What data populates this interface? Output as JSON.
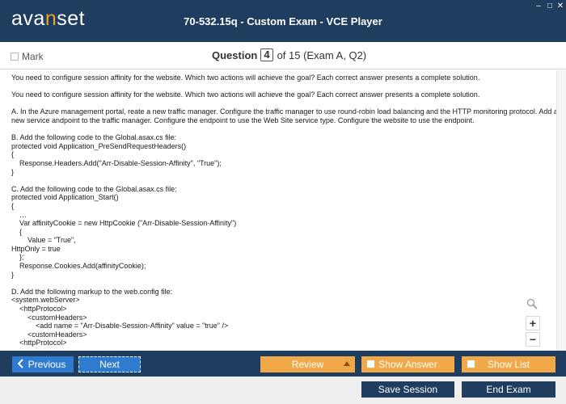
{
  "app": {
    "logo_prefix": "ava",
    "logo_accent": "n",
    "logo_suffix": "set",
    "window_title": "70-532.15q - Custom Exam - VCE Player"
  },
  "window_controls": {
    "close": "✕",
    "maximize": "□",
    "minimize": "‒"
  },
  "question_bar": {
    "mark_label": "Mark",
    "question_label": "Question",
    "question_number": "4",
    "question_of": "of 15 (Exam A, Q2)"
  },
  "content": {
    "lines": [
      "You need to configure session affinity for the website. Which two actions will achieve the goal? Each correct answer presents a complete solution.",
      "",
      "You need to configure session affinity for the website. Which two actions will achieve the goal? Each correct answer presents a complete solution.",
      "",
      "A. In the Azure management portal, reate a new traffic manager. Configure the traffic manager to use round-robin load balancing and the HTTP monitoring protocol. Add a",
      "new service andpoint to the traffic manager. Configure the endpoint to use the Web Site service type. Configure the website to use the endpoint.",
      "",
      "B. Add the following code to the Global.asax.cs file:",
      "protected void Application_PreSendRequestHeaders()",
      "{",
      "    Response.Headers.Add(\"Arr-Disable-Session-Affinity\", \"True\");",
      "}",
      "",
      "C. Add the following code to the Global.asax.cs file:",
      "protected void Application_Start()",
      "{",
      "    …",
      "    Var affinityCookie = new HttpCookie (\"Arr-Disable-Session-Affinity\")",
      "    {",
      "        Value = \"True\",",
      "HttpOnly = true",
      "    };",
      "    Response.Cookies.Add(affinityCookie);",
      "}",
      "",
      "D. Add the following markup to the web.config file:",
      "<system.webServer>",
      "    <httpProtocol>",
      "        <customHeaders>",
      "            <add name = \"Arr-Disable-Session-Affinity\" value = \"true\" />",
      "        <customHeaders>",
      "    <httpProtocol>"
    ]
  },
  "zoom": {
    "zoom_in": "+",
    "zoom_out": "−"
  },
  "nav": {
    "previous": "Previous",
    "next": "Next",
    "review": "Review",
    "show_answer": "Show Answer",
    "show_list": "Show List"
  },
  "bottom": {
    "save_session": "Save Session",
    "end_exam": "End Exam"
  },
  "colors": {
    "titlebar": "#1f3d5f",
    "blue_button": "#2f7bd0",
    "orange_button": "#f0a848",
    "logo_accent": "#f0a030"
  },
  "icons": {
    "previous": "chevron-left-icon",
    "search": "zoom-search-icon",
    "review": "triangle-up-icon"
  }
}
